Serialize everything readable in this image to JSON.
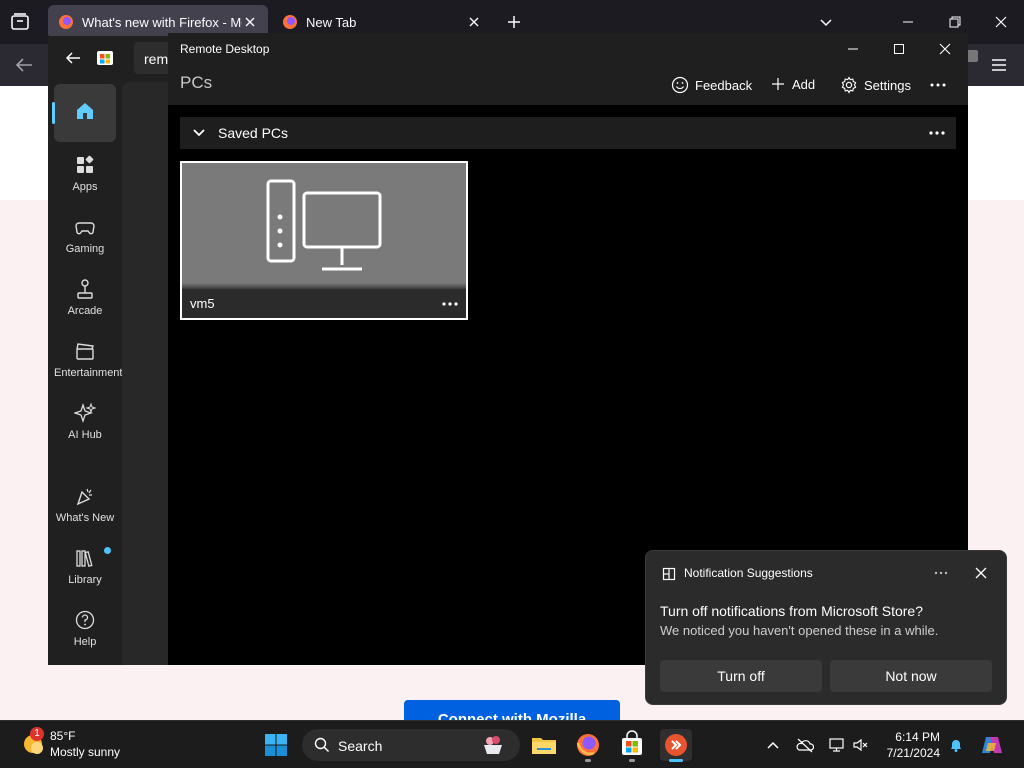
{
  "firefox": {
    "tabs": [
      {
        "title": "What's new with Firefox - More",
        "active": true
      },
      {
        "title": "New Tab",
        "active": false
      }
    ],
    "page_button": "Connect with Mozilla"
  },
  "store": {
    "search_value": "rem",
    "nav": [
      {
        "label": "Apps"
      },
      {
        "label": "Gaming"
      },
      {
        "label": "Arcade"
      },
      {
        "label": "Entertainment"
      },
      {
        "label": "AI Hub"
      },
      {
        "label": "What's New"
      },
      {
        "label": "Library"
      },
      {
        "label": "Help"
      }
    ]
  },
  "remote_desktop": {
    "window_title": "Remote Desktop",
    "page_title": "PCs",
    "header": {
      "feedback": "Feedback",
      "add": "Add",
      "settings": "Settings"
    },
    "group": {
      "label": "Saved PCs"
    },
    "pcs": [
      {
        "name": "vm5"
      }
    ]
  },
  "notification": {
    "app": "Notification Suggestions",
    "title": "Turn off notifications from Microsoft Store?",
    "body": "We noticed you haven't opened these in a while.",
    "btn_turn_off": "Turn off",
    "btn_not_now": "Not now"
  },
  "taskbar": {
    "weather": {
      "temp": "85°F",
      "desc": "Mostly sunny",
      "badge": "1"
    },
    "search_placeholder": "Search",
    "time": "6:14 PM",
    "date": "7/21/2024"
  },
  "colors": {
    "accent": "#4cc2ff",
    "firefox_blue": "#0061e0"
  }
}
